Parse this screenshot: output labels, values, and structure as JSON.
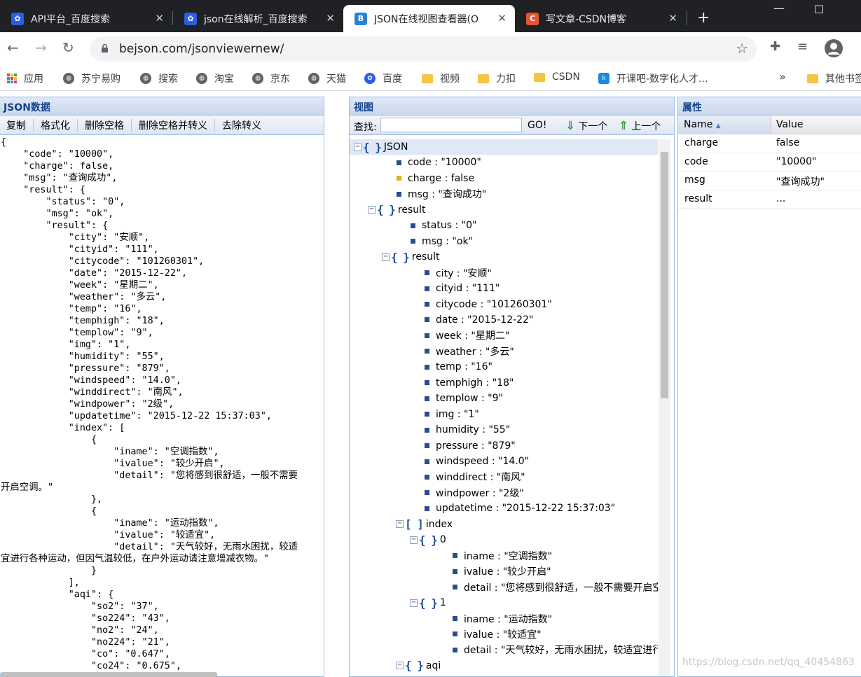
{
  "browser": {
    "tabs": [
      {
        "title": "API平台_百度搜索",
        "close": "✕"
      },
      {
        "title": "json在线解析_百度搜索",
        "close": "✕"
      },
      {
        "title": "JSON在线视图查看器(O",
        "close": "✕"
      },
      {
        "title": "写文章-CSDN博客",
        "close": "✕"
      }
    ],
    "new_tab": "+",
    "url": "bejson.com/jsonviewernew/",
    "bookmarks": [
      {
        "label": "应用",
        "icon": "apps-grid-icon"
      },
      {
        "label": "苏宁易购",
        "icon": "globe-icon"
      },
      {
        "label": "搜索",
        "icon": "globe-icon"
      },
      {
        "label": "淘宝",
        "icon": "globe-icon"
      },
      {
        "label": "京东",
        "icon": "globe-icon"
      },
      {
        "label": "天猫",
        "icon": "globe-icon"
      },
      {
        "label": "百度",
        "icon": "baidu-paw-icon"
      },
      {
        "label": "视频",
        "icon": "folder-icon"
      },
      {
        "label": "力扣",
        "icon": "folder-icon"
      },
      {
        "label": "CSDN",
        "icon": "folder-icon"
      },
      {
        "label": "开课吧-数字化人才...",
        "icon": "kaikeba-icon"
      },
      {
        "label": "其他书签",
        "icon": "folder-icon"
      }
    ],
    "more": "»"
  },
  "left_panel": {
    "title": "JSON数据",
    "toolbar": [
      "复制",
      "格式化",
      "删除空格",
      "删除空格并转义",
      "去除转义"
    ],
    "code": "{\n    \"code\": \"10000\",\n    \"charge\": false,\n    \"msg\": \"查询成功\",\n    \"result\": {\n        \"status\": \"0\",\n        \"msg\": \"ok\",\n        \"result\": {\n            \"city\": \"安顺\",\n            \"cityid\": \"111\",\n            \"citycode\": \"101260301\",\n            \"date\": \"2015-12-22\",\n            \"week\": \"星期二\",\n            \"weather\": \"多云\",\n            \"temp\": \"16\",\n            \"temphigh\": \"18\",\n            \"templow\": \"9\",\n            \"img\": \"1\",\n            \"humidity\": \"55\",\n            \"pressure\": \"879\",\n            \"windspeed\": \"14.0\",\n            \"winddirect\": \"南风\",\n            \"windpower\": \"2级\",\n            \"updatetime\": \"2015-12-22 15:37:03\",\n            \"index\": [\n                {\n                    \"iname\": \"空调指数\",\n                    \"ivalue\": \"较少开启\",\n                    \"detail\": \"您将感到很舒适，一般不需要\n开启空调。\"\n                },\n                {\n                    \"iname\": \"运动指数\",\n                    \"ivalue\": \"较适宜\",\n                    \"detail\": \"天气较好，无雨水困扰，较适\n宜进行各种运动，但因气温较低，在户外运动请注意增减衣物。\"\n                }\n            ],\n            \"aqi\": {\n                \"so2\": \"37\",\n                \"so224\": \"43\",\n                \"no2\": \"24\",\n                \"no224\": \"21\",\n                \"co\": \"0.647\",\n                \"co24\": \"0.675\","
  },
  "mid_panel": {
    "title": "视图",
    "search_label": "查找:",
    "search_value": "",
    "go_label": "GO!",
    "next_label": "下一个",
    "prev_label": "上一个",
    "tree": [
      {
        "level": 0,
        "kind": "object",
        "text": "JSON",
        "toggle": "⊟",
        "selected": true
      },
      {
        "level": 1,
        "kind": "leaf",
        "text": "code : \"10000\""
      },
      {
        "level": 1,
        "kind": "bool",
        "text": "charge : false"
      },
      {
        "level": 1,
        "kind": "leaf",
        "text": "msg : \"查询成功\""
      },
      {
        "level": 1,
        "kind": "object",
        "text": "result",
        "toggle": "⊟"
      },
      {
        "level": 2,
        "kind": "leaf",
        "text": "status : \"0\""
      },
      {
        "level": 2,
        "kind": "leaf",
        "text": "msg : \"ok\""
      },
      {
        "level": 2,
        "kind": "object",
        "text": "result",
        "toggle": "⊟"
      },
      {
        "level": 3,
        "kind": "leaf",
        "text": "city : \"安顺\""
      },
      {
        "level": 3,
        "kind": "leaf",
        "text": "cityid : \"111\""
      },
      {
        "level": 3,
        "kind": "leaf",
        "text": "citycode : \"101260301\""
      },
      {
        "level": 3,
        "kind": "leaf",
        "text": "date : \"2015-12-22\""
      },
      {
        "level": 3,
        "kind": "leaf",
        "text": "week : \"星期二\""
      },
      {
        "level": 3,
        "kind": "leaf",
        "text": "weather : \"多云\""
      },
      {
        "level": 3,
        "kind": "leaf",
        "text": "temp : \"16\""
      },
      {
        "level": 3,
        "kind": "leaf",
        "text": "temphigh : \"18\""
      },
      {
        "level": 3,
        "kind": "leaf",
        "text": "templow : \"9\""
      },
      {
        "level": 3,
        "kind": "leaf",
        "text": "img : \"1\""
      },
      {
        "level": 3,
        "kind": "leaf",
        "text": "humidity : \"55\""
      },
      {
        "level": 3,
        "kind": "leaf",
        "text": "pressure : \"879\""
      },
      {
        "level": 3,
        "kind": "leaf",
        "text": "windspeed : \"14.0\""
      },
      {
        "level": 3,
        "kind": "leaf",
        "text": "winddirect : \"南风\""
      },
      {
        "level": 3,
        "kind": "leaf",
        "text": "windpower : \"2级\""
      },
      {
        "level": 3,
        "kind": "leaf",
        "text": "updatetime : \"2015-12-22 15:37:03\""
      },
      {
        "level": 3,
        "kind": "array",
        "text": "index",
        "toggle": "⊟"
      },
      {
        "level": 4,
        "kind": "object",
        "text": "0",
        "toggle": "⊟"
      },
      {
        "level": 5,
        "kind": "leaf",
        "text": "iname : \"空调指数\""
      },
      {
        "level": 5,
        "kind": "leaf",
        "text": "ivalue : \"较少开启\""
      },
      {
        "level": 5,
        "kind": "leaf",
        "text": "detail : \"您将感到很舒适，一般不需要开启空调。\""
      },
      {
        "level": 4,
        "kind": "object",
        "text": "1",
        "toggle": "⊟"
      },
      {
        "level": 5,
        "kind": "leaf",
        "text": "iname : \"运动指数\""
      },
      {
        "level": 5,
        "kind": "leaf",
        "text": "ivalue : \"较适宜\""
      },
      {
        "level": 5,
        "kind": "leaf",
        "text": "detail : \"天气较好，无雨水困扰，较适宜进行各种运动\""
      },
      {
        "level": 3,
        "kind": "object",
        "text": "aqi",
        "toggle": "⊟"
      }
    ]
  },
  "right_panel": {
    "title": "属性",
    "col_name": "Name",
    "col_value": "Value",
    "rows": [
      {
        "name": "charge",
        "value": "false"
      },
      {
        "name": "code",
        "value": "\"10000\""
      },
      {
        "name": "msg",
        "value": "\"查询成功\""
      },
      {
        "name": "result",
        "value": "..."
      }
    ]
  },
  "watermark": "https://blog.csdn.net/qq_40454863"
}
